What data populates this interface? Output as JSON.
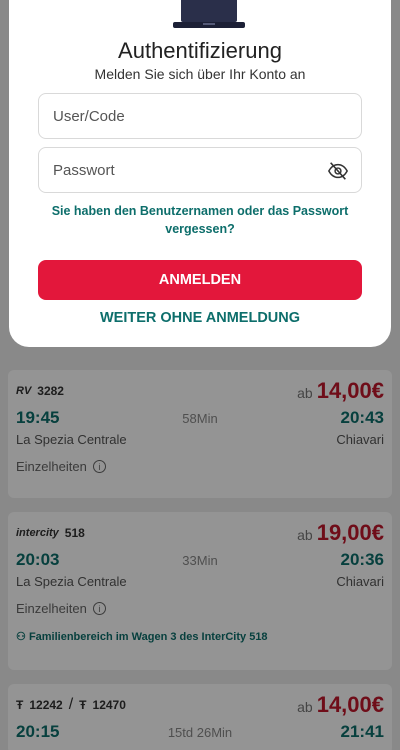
{
  "auth": {
    "title": "Authentifizierung",
    "subtitle": "Melden Sie sich über Ihr Konto an",
    "user_placeholder": "User/Code",
    "password_placeholder": "Passwort",
    "forgot_line1": "Sie haben den Benutzernamen oder das Passwort",
    "forgot_line2": "vergessen?",
    "login_label": "ANMELDEN",
    "guest_label": "WEITER OHNE ANMELDUNG"
  },
  "trips": [
    {
      "train_logo": "RV",
      "train_number": "3282",
      "ab": "ab",
      "price": "14,00€",
      "departure": "19:45",
      "duration": "58Min",
      "arrival": "20:43",
      "from": "La Spezia Centrale",
      "to": "Chiavari",
      "details": "Einzelheiten"
    },
    {
      "train_logo": "intercity",
      "train_number": "518",
      "ab": "ab",
      "price": "19,00€",
      "departure": "20:03",
      "duration": "33Min",
      "arrival": "20:36",
      "from": "La Spezia Centrale",
      "to": "Chiavari",
      "details": "Einzelheiten",
      "note": "Familienbereich im Wagen 3 des InterCity 518"
    },
    {
      "train_number_1": "12242",
      "separator": "/",
      "train_number_2": "12470",
      "ab": "ab",
      "price": "14,00€",
      "departure": "20:15",
      "duration": "15td 26Min",
      "arrival": "21:41"
    }
  ],
  "colors": {
    "accent_red": "#e3173b",
    "teal": "#0d6e6b"
  },
  "icons": {
    "laptop": "laptop-icon",
    "eye_off": "eye-off-icon",
    "info": "info-icon",
    "family": "family-icon",
    "train": "regional-train-icon"
  }
}
